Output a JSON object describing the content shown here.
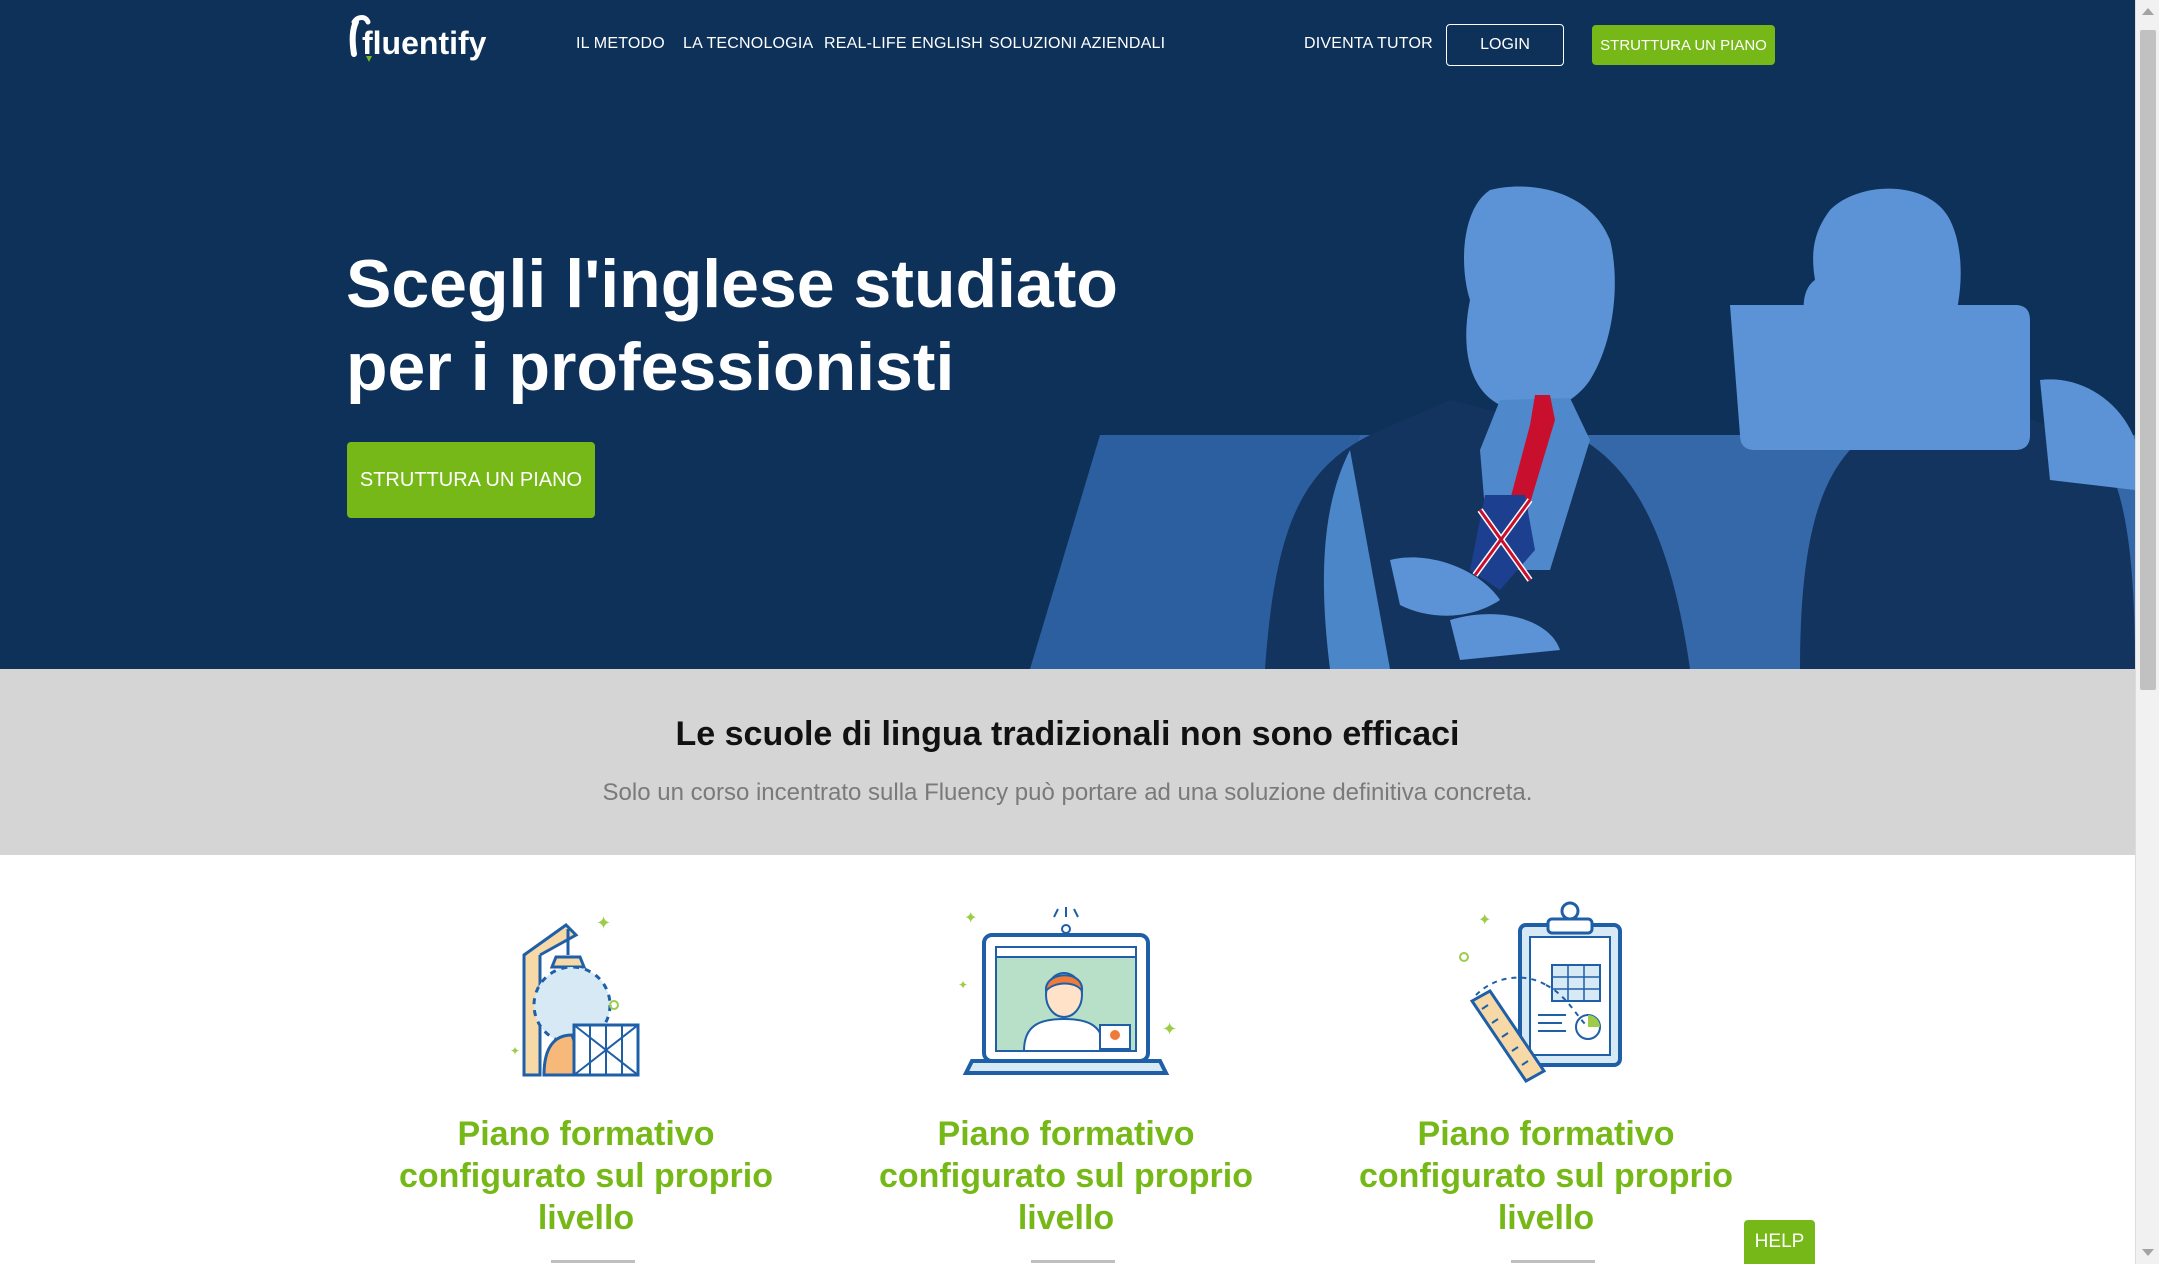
{
  "brand": {
    "logo_text": "fluentify",
    "accent_color": "#76b817",
    "hero_bg": "#0e3159"
  },
  "nav": {
    "links": [
      "IL METODO",
      "LA TECNOLOGIA",
      "REAL-LIFE ENGLISH",
      "SOLUZIONI AZIENDALI"
    ],
    "become_tutor": "DIVENTA TUTOR",
    "login": "LOGIN",
    "plan_button": "STRUTTURA UN PIANO"
  },
  "hero": {
    "title_line1": "Scegli l'inglese studiato",
    "title_line2": "per i professionisti",
    "cta": "STRUTTURA UN PIANO"
  },
  "band": {
    "heading": "Le scuole di lingua tradizionali non sono efficaci",
    "subheading": "Solo un corso incentrato sulla Fluency può portare ad una soluzione definitiva concreta."
  },
  "features": [
    {
      "icon": "mannequin-icon",
      "line1": "Piano formativo",
      "line2": "configurato sul proprio",
      "line3": "livello"
    },
    {
      "icon": "laptop-video-call-icon",
      "line1": "Piano formativo",
      "line2": "configurato sul proprio",
      "line3": "livello"
    },
    {
      "icon": "clipboard-ruler-icon",
      "line1": "Piano formativo",
      "line2": "configurato sul proprio",
      "line3": "livello"
    }
  ],
  "help": "HELP"
}
